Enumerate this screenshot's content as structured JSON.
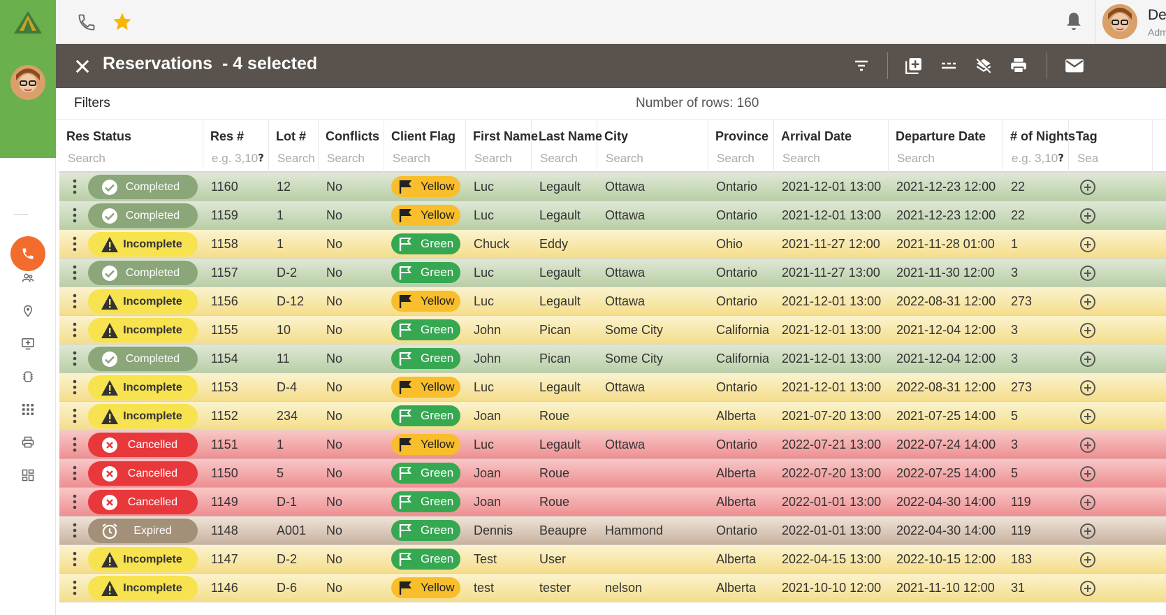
{
  "app": {
    "user_name": "De",
    "user_role": "Adm"
  },
  "colors": {
    "brand_green": "#6ab04c",
    "accent_orange": "#f26c2d",
    "titlebar": "#5a534d",
    "star": "#f5b50a"
  },
  "topbar": {
    "icons": [
      "phone-icon",
      "star-icon",
      "bell-icon"
    ]
  },
  "rail": {
    "items": [
      "phone-icon",
      "people-icon",
      "location-pin-icon",
      "add-screen-icon",
      "chip-icon",
      "apps-grid-icon",
      "printer-icon",
      "dashboard-icon"
    ]
  },
  "titlebar": {
    "title": "Reservations",
    "selection": "- 4 selected",
    "actions": [
      "filter-icon",
      "add-box-icon",
      "dashes-icon",
      "layers-off-icon",
      "printer-icon",
      "mail-icon"
    ]
  },
  "filters": {
    "label": "Filters",
    "row_count": "Number of rows: 160"
  },
  "columns": [
    {
      "label": "Res Status",
      "placeholder": "Search"
    },
    {
      "label": "Res #",
      "placeholder": "e.g. 3,10",
      "help": "?"
    },
    {
      "label": "Lot #",
      "placeholder": "Search"
    },
    {
      "label": "Conflicts",
      "placeholder": "Search"
    },
    {
      "label": "Client Flag",
      "placeholder": "Search"
    },
    {
      "label": "First Name",
      "placeholder": "Search"
    },
    {
      "label": "Last Name",
      "placeholder": "Search"
    },
    {
      "label": "City",
      "placeholder": "Search"
    },
    {
      "label": "Province",
      "placeholder": "Search"
    },
    {
      "label": "Arrival Date",
      "placeholder": "Search"
    },
    {
      "label": "Departure Date",
      "placeholder": "Search"
    },
    {
      "label": "# of Nights",
      "placeholder": "e.g. 3,10",
      "help": "?"
    },
    {
      "label": "Tag",
      "placeholder": "Sea"
    }
  ],
  "rows": [
    {
      "status": "Completed",
      "res": "1160",
      "lot": "12",
      "conflicts": "No",
      "flag": "Yellow",
      "first": "Luc",
      "last": "Legault",
      "city": "Ottawa",
      "province": "Ontario",
      "arrival": "2021-12-01 13:00",
      "departure": "2021-12-23 12:00",
      "nights": "22"
    },
    {
      "status": "Completed",
      "res": "1159",
      "lot": "1",
      "conflicts": "No",
      "flag": "Yellow",
      "first": "Luc",
      "last": "Legault",
      "city": "Ottawa",
      "province": "Ontario",
      "arrival": "2021-12-01 13:00",
      "departure": "2021-12-23 12:00",
      "nights": "22"
    },
    {
      "status": "Incomplete",
      "res": "1158",
      "lot": "1",
      "conflicts": "No",
      "flag": "Green",
      "first": "Chuck",
      "last": "Eddy",
      "city": "",
      "province": "Ohio",
      "arrival": "2021-11-27 12:00",
      "departure": "2021-11-28 01:00",
      "nights": "1"
    },
    {
      "status": "Completed",
      "res": "1157",
      "lot": "D-2",
      "conflicts": "No",
      "flag": "Green",
      "first": "Luc",
      "last": "Legault",
      "city": "Ottawa",
      "province": "Ontario",
      "arrival": "2021-11-27 13:00",
      "departure": "2021-11-30 12:00",
      "nights": "3"
    },
    {
      "status": "Incomplete",
      "res": "1156",
      "lot": "D-12",
      "conflicts": "No",
      "flag": "Yellow",
      "first": "Luc",
      "last": "Legault",
      "city": "Ottawa",
      "province": "Ontario",
      "arrival": "2021-12-01 13:00",
      "departure": "2022-08-31 12:00",
      "nights": "273"
    },
    {
      "status": "Incomplete",
      "res": "1155",
      "lot": "10",
      "conflicts": "No",
      "flag": "Green",
      "first": "John",
      "last": "Pican",
      "city": "Some City",
      "province": "California",
      "arrival": "2021-12-01 13:00",
      "departure": "2021-12-04 12:00",
      "nights": "3"
    },
    {
      "status": "Completed",
      "res": "1154",
      "lot": "11",
      "conflicts": "No",
      "flag": "Green",
      "first": "John",
      "last": "Pican",
      "city": "Some City",
      "province": "California",
      "arrival": "2021-12-01 13:00",
      "departure": "2021-12-04 12:00",
      "nights": "3"
    },
    {
      "status": "Incomplete",
      "res": "1153",
      "lot": "D-4",
      "conflicts": "No",
      "flag": "Yellow",
      "first": "Luc",
      "last": "Legault",
      "city": "Ottawa",
      "province": "Ontario",
      "arrival": "2021-12-01 13:00",
      "departure": "2022-08-31 12:00",
      "nights": "273"
    },
    {
      "status": "Incomplete",
      "res": "1152",
      "lot": "234",
      "conflicts": "No",
      "flag": "Green",
      "first": "Joan",
      "last": "Roue",
      "city": "",
      "province": "Alberta",
      "arrival": "2021-07-20 13:00",
      "departure": "2021-07-25 14:00",
      "nights": "5"
    },
    {
      "status": "Cancelled",
      "res": "1151",
      "lot": "1",
      "conflicts": "No",
      "flag": "Yellow",
      "first": "Luc",
      "last": "Legault",
      "city": "Ottawa",
      "province": "Ontario",
      "arrival": "2022-07-21 13:00",
      "departure": "2022-07-24 14:00",
      "nights": "3"
    },
    {
      "status": "Cancelled",
      "res": "1150",
      "lot": "5",
      "conflicts": "No",
      "flag": "Green",
      "first": "Joan",
      "last": "Roue",
      "city": "",
      "province": "Alberta",
      "arrival": "2022-07-20 13:00",
      "departure": "2022-07-25 14:00",
      "nights": "5"
    },
    {
      "status": "Cancelled",
      "res": "1149",
      "lot": "D-1",
      "conflicts": "No",
      "flag": "Green",
      "first": "Joan",
      "last": "Roue",
      "city": "",
      "province": "Alberta",
      "arrival": "2022-01-01 13:00",
      "departure": "2022-04-30 14:00",
      "nights": "119"
    },
    {
      "status": "Expired",
      "res": "1148",
      "lot": "A001",
      "conflicts": "No",
      "flag": "Green",
      "first": "Dennis",
      "last": "Beaupre",
      "city": "Hammond",
      "province": "Ontario",
      "arrival": "2022-01-01 13:00",
      "departure": "2022-04-30 14:00",
      "nights": "119"
    },
    {
      "status": "Incomplete",
      "res": "1147",
      "lot": "D-2",
      "conflicts": "No",
      "flag": "Green",
      "first": "Test",
      "last": "User",
      "city": "",
      "province": "Alberta",
      "arrival": "2022-04-15 13:00",
      "departure": "2022-10-15 12:00",
      "nights": "183"
    },
    {
      "status": "Incomplete",
      "res": "1146",
      "lot": "D-6",
      "conflicts": "No",
      "flag": "Yellow",
      "first": "test",
      "last": "tester",
      "city": "nelson",
      "province": "Alberta",
      "arrival": "2021-10-10 12:00",
      "departure": "2021-11-10 12:00",
      "nights": "31"
    }
  ]
}
